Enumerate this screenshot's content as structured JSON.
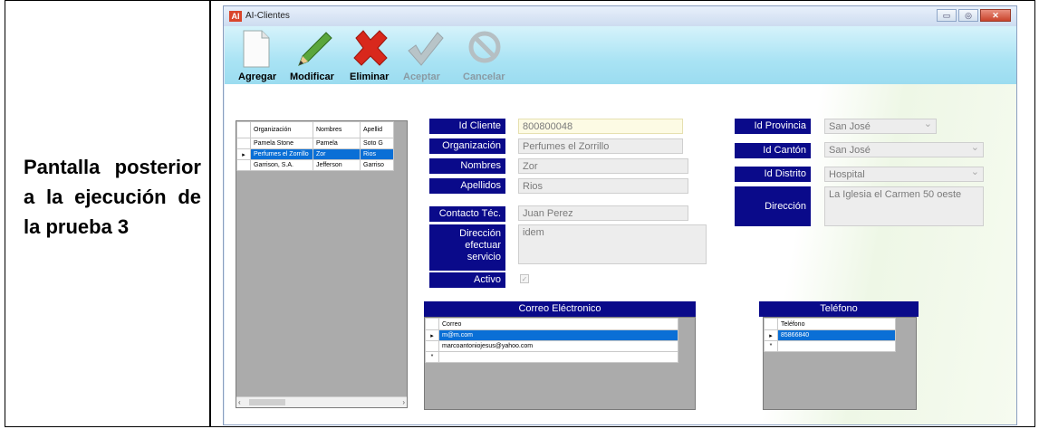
{
  "caption": "Pantalla posterior a la ejecución de la prueba 3",
  "window": {
    "icon": "AI",
    "title": "AI-Clientes",
    "controls": [
      "minimize-icon",
      "restore-icon",
      "close-icon"
    ]
  },
  "toolbar": {
    "agregar": "Agregar",
    "modificar": "Modificar",
    "eliminar": "Eliminar",
    "aceptar": "Aceptar",
    "cancelar": "Cancelar"
  },
  "clients_grid": {
    "headers": [
      "Organización",
      "Nombres",
      "Apellid"
    ],
    "rows": [
      [
        "Pamela Stone",
        "Pamela",
        "Soto G"
      ],
      [
        "Perfumes el Zorrillo",
        "Zor",
        "Rios"
      ],
      [
        "Garrison, S.A.",
        "Jefferson",
        "Garriso"
      ]
    ],
    "selected_row": 1
  },
  "form": {
    "id_cliente": {
      "label": "Id Cliente",
      "value": "800800048"
    },
    "organizacion": {
      "label": "Organización",
      "value": "Perfumes el Zorrillo"
    },
    "nombres": {
      "label": "Nombres",
      "value": "Zor"
    },
    "apellidos": {
      "label": "Apellidos",
      "value": "Rios"
    },
    "contacto": {
      "label": "Contacto Téc.",
      "value": "Juan Perez"
    },
    "direccion_servicio": {
      "label_lines": [
        "Dirección",
        "efectuar",
        "servicio"
      ],
      "value": "idem"
    },
    "activo": {
      "label": "Activo",
      "checked": true
    },
    "id_provincia": {
      "label": "Id Provincia",
      "value": "San José"
    },
    "id_canton": {
      "label": "Id Cantón",
      "value": "San José"
    },
    "id_distrito": {
      "label": "Id Distrito",
      "value": "Hospital"
    },
    "direccion": {
      "label": "Dirección",
      "value": "La Iglesia el Carmen 50 oeste"
    }
  },
  "correo": {
    "title": "Correo Eléctronico",
    "header": "Correo",
    "rows": [
      "m@m.com",
      "marcoantoniojesus@yahoo.com"
    ]
  },
  "telefono": {
    "title": "Teléfono",
    "header": "Teléfono",
    "rows": [
      "85866840"
    ]
  },
  "colors": {
    "label_bg": "#0a0a8a",
    "toolbar_bg": "#a9e3f4",
    "selection": "#0a6fd6"
  }
}
